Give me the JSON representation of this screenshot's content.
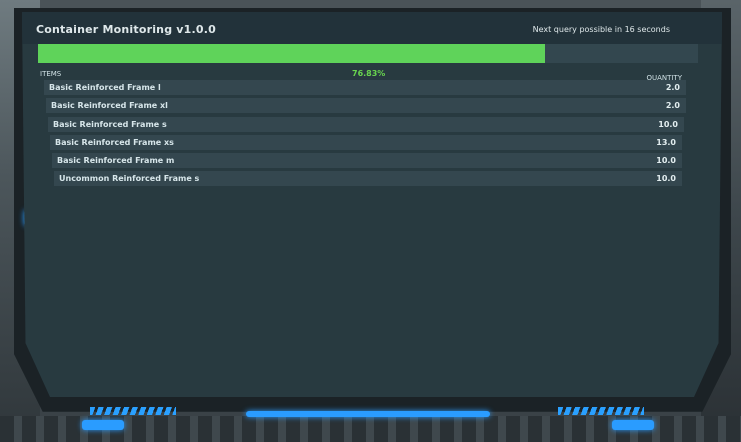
{
  "monitor": {
    "title": "Container Monitoring v1.0.0",
    "query_status": "Next query possible in 16 seconds",
    "progress_percent_label": "76.83%",
    "progress_fraction": 0.7683,
    "column_items": "ITEMS",
    "column_quantity": "QUANTITY",
    "rows": [
      {
        "name": "Basic Reinforced Frame l",
        "quantity": "2.0"
      },
      {
        "name": "Basic Reinforced Frame xl",
        "quantity": "2.0"
      },
      {
        "name": "Basic Reinforced Frame s",
        "quantity": "10.0"
      },
      {
        "name": "Basic Reinforced Frame xs",
        "quantity": "13.0"
      },
      {
        "name": "Basic Reinforced Frame m",
        "quantity": "10.0"
      },
      {
        "name": "Uncommon Reinforced Frame s",
        "quantity": "10.0"
      }
    ]
  },
  "colors": {
    "progress": "#5fd35a",
    "percent_text": "#69d64f",
    "screen": "#283a40",
    "row": "#34474f",
    "accent_glow": "#2a9cff"
  }
}
